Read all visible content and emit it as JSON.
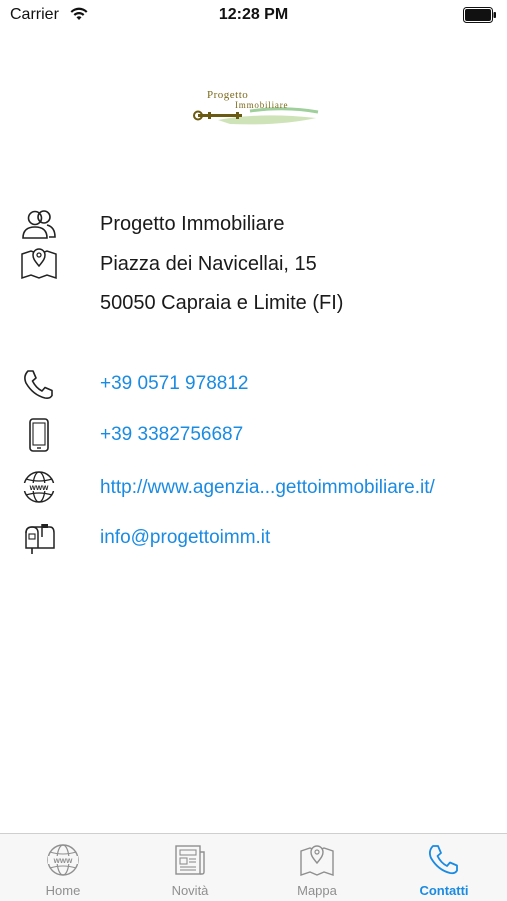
{
  "status_bar": {
    "carrier": "Carrier",
    "time": "12:28 PM"
  },
  "logo": {
    "line1": "Progetto",
    "line2": "Immobiliare"
  },
  "contact": {
    "name": "Progetto Immobiliare",
    "address_line1": "Piazza dei Navicellai, 15",
    "address_line2": "50050 Capraia e Limite (FI)",
    "phone": "+39 0571 978812",
    "mobile": "+39 3382756687",
    "website": "http://www.agenzia...gettoimmobiliare.it/",
    "email": "info@progettoimm.it"
  },
  "tabs": [
    {
      "label": "Home",
      "icon": "globe-icon"
    },
    {
      "label": "Novità",
      "icon": "newspaper-icon"
    },
    {
      "label": "Mappa",
      "icon": "map-icon"
    },
    {
      "label": "Contatti",
      "icon": "phone-icon"
    }
  ],
  "colors": {
    "accent": "#1a8be2",
    "tab_inactive": "#8f8f8f"
  }
}
